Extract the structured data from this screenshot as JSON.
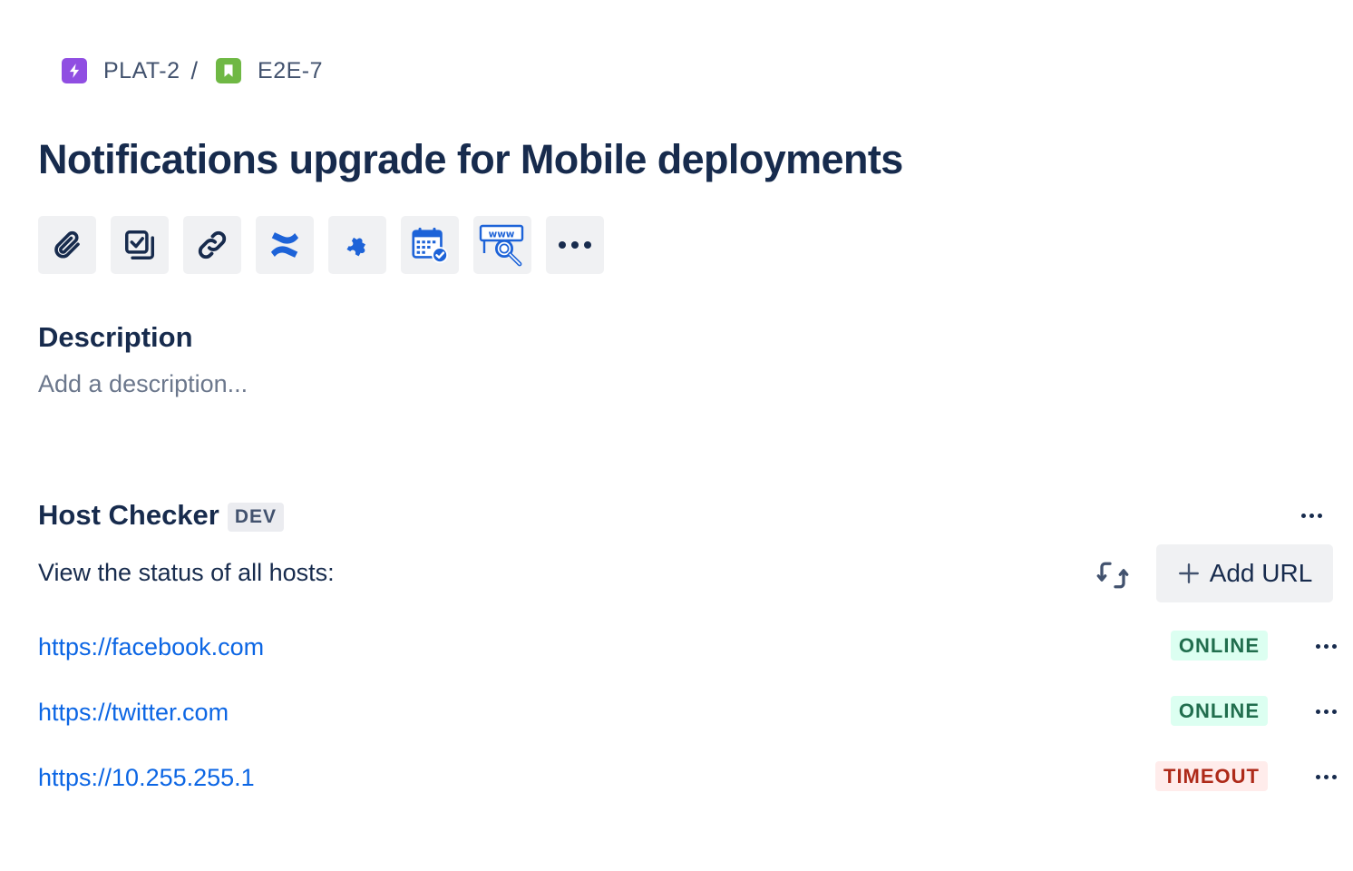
{
  "breadcrumb": {
    "items": [
      {
        "key": "PLAT-2",
        "icon": "lightning-icon",
        "color": "#904ee2"
      },
      {
        "key": "E2E-7",
        "icon": "bookmark-icon",
        "color": "#6fb844"
      }
    ],
    "separator": "/"
  },
  "issue": {
    "title": "Notifications upgrade for Mobile deployments"
  },
  "toolbar": {
    "buttons": [
      {
        "name": "attach",
        "icon": "paperclip-icon"
      },
      {
        "name": "subtasks",
        "icon": "checklist-icon"
      },
      {
        "name": "link-issue",
        "icon": "link-icon"
      },
      {
        "name": "confluence",
        "icon": "confluence-icon"
      },
      {
        "name": "apps",
        "icon": "puzzle-icon"
      },
      {
        "name": "calendar",
        "icon": "calendar-check-icon"
      },
      {
        "name": "host-checker",
        "icon": "www-search-icon"
      },
      {
        "name": "more",
        "icon": "more-icon"
      }
    ]
  },
  "description": {
    "heading": "Description",
    "placeholder": "Add a description..."
  },
  "host_checker": {
    "title": "Host Checker",
    "badge": "DEV",
    "subtitle": "View the status of all hosts:",
    "add_url_label": "Add URL",
    "hosts": [
      {
        "url": "https://facebook.com",
        "status": "ONLINE"
      },
      {
        "url": "https://twitter.com",
        "status": "ONLINE"
      },
      {
        "url": "https://10.255.255.1",
        "status": "TIMEOUT"
      }
    ]
  },
  "colors": {
    "text": "#172b4d",
    "link": "#0c66e4",
    "online_bg": "#dcfff1",
    "online_text": "#216e4e",
    "timeout_bg": "#ffeceb",
    "timeout_text": "#ae2a19",
    "button_bg": "#f0f1f3",
    "icon_blue": "#1d63d8"
  }
}
